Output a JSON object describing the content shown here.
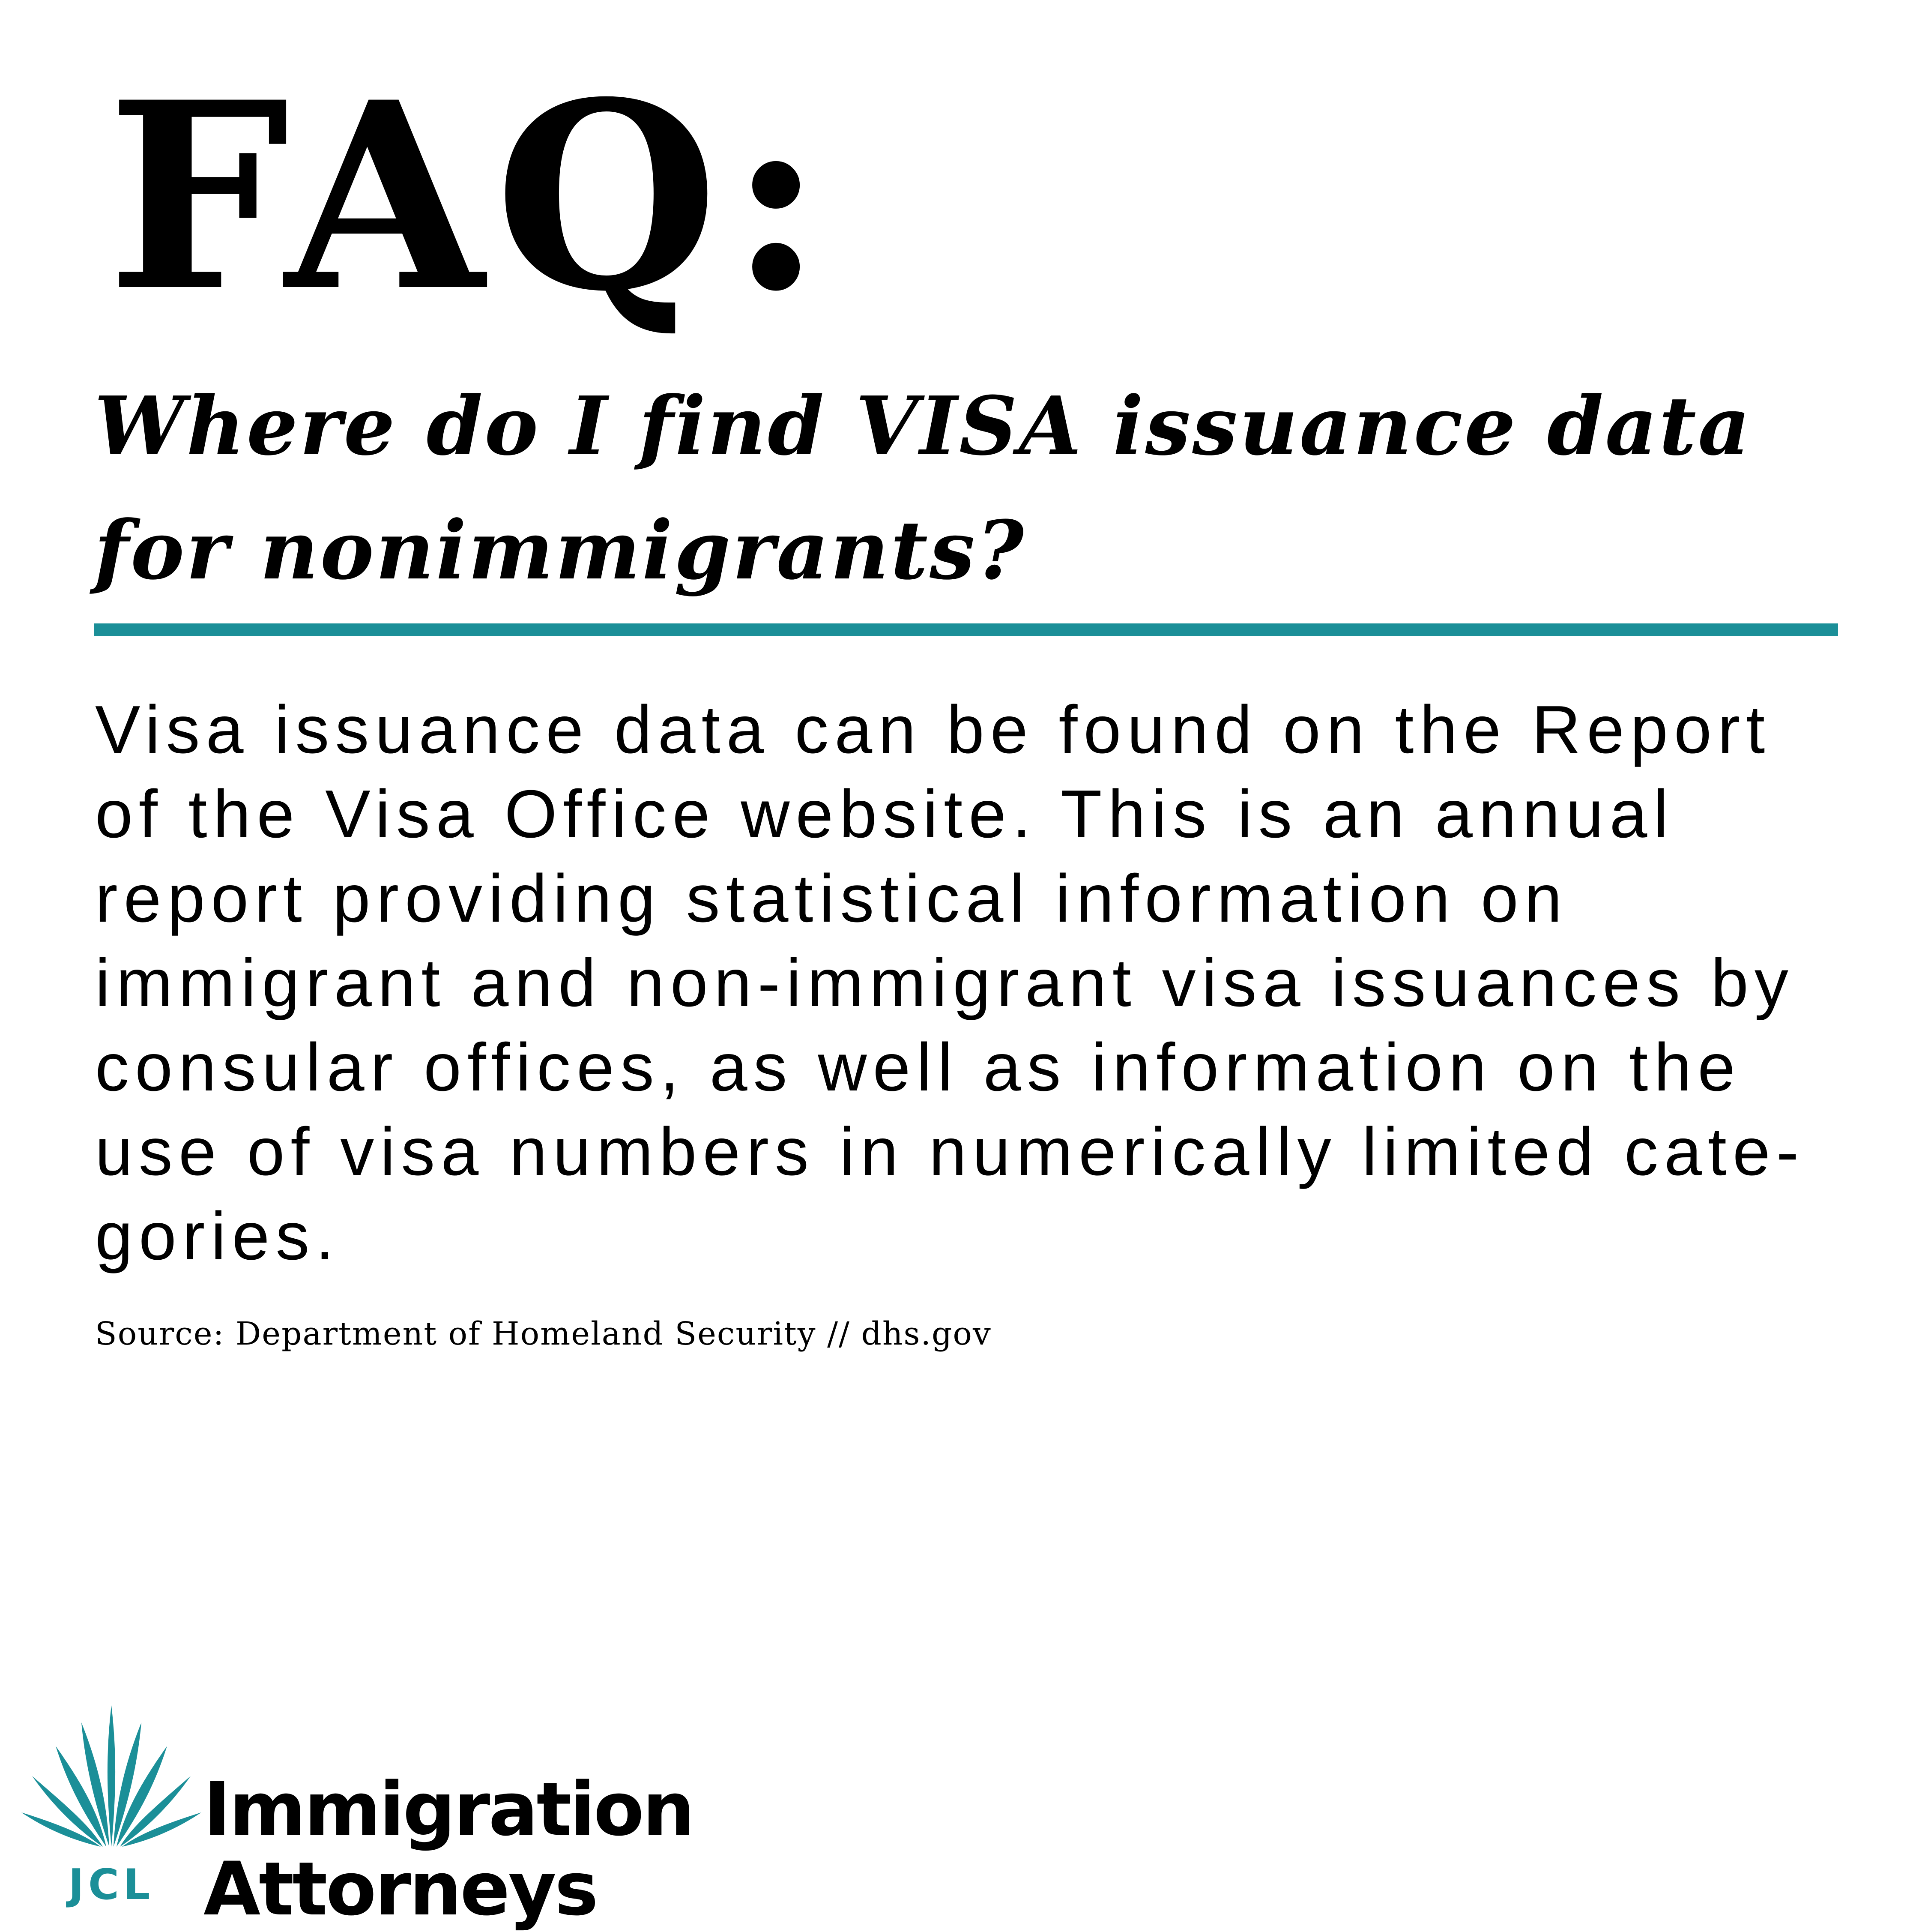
{
  "heading": "FAQ:",
  "question": {
    "lines": [
      "Where do I find VISA issuance data",
      "for nonimmigrants?"
    ]
  },
  "answer": {
    "lines": [
      "Visa issuance data can be found on the Report",
      "of the Visa Office website. This is an annual",
      "report providing statistical information on",
      "immigrant and non-immigrant visa issuances by",
      "consular offices, as well as information on the",
      "use of visa numbers in numerically limited cate-",
      "gories."
    ]
  },
  "source": "Source: Department of Homeland Security // dhs.gov",
  "logo": {
    "initials": "JCL",
    "name_line_1": "Immigration",
    "name_line_2": "Attorneys",
    "icon": "agave-leaves-icon"
  },
  "colors": {
    "accent": "#1b8f98",
    "text": "#000000",
    "background": "#ffffff"
  }
}
